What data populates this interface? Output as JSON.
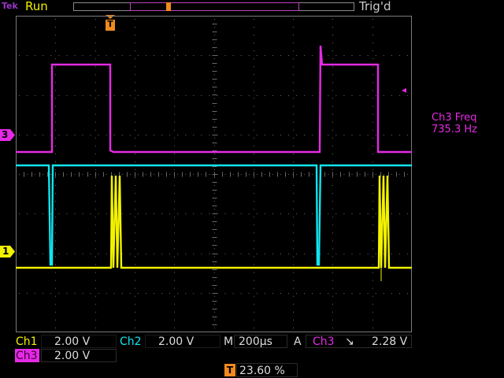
{
  "header": {
    "brand": "Tek",
    "run_state": "Run",
    "trigger_status": "Trig'd",
    "trigger_marker": "T"
  },
  "markers": {
    "ch3": "3",
    "ch1": "1",
    "trigger_level_arrow": "◂"
  },
  "measurement": {
    "label": "Ch3 Freq",
    "value": "735.3 Hz"
  },
  "status_bar": {
    "ch1_label": "Ch1",
    "ch1_scale": "2.00 V",
    "ch2_label": "Ch2",
    "ch2_scale": "2.00 V",
    "timebase_label": "M",
    "timebase_value": "200µs",
    "trigger_mode": "A",
    "trigger_source": "Ch3",
    "trigger_slope": "↘",
    "trigger_level": "2.28 V",
    "ch3_label": "Ch3",
    "ch3_scale": "2.00 V",
    "trigger_position_icon": "T",
    "trigger_position": "23.60 %"
  },
  "colors": {
    "ch1": "#f2f200",
    "ch2": "#10e5f0",
    "ch3": "#e52ae5",
    "trigger": "#f08a1e",
    "grid": "#6a6a6a"
  }
}
